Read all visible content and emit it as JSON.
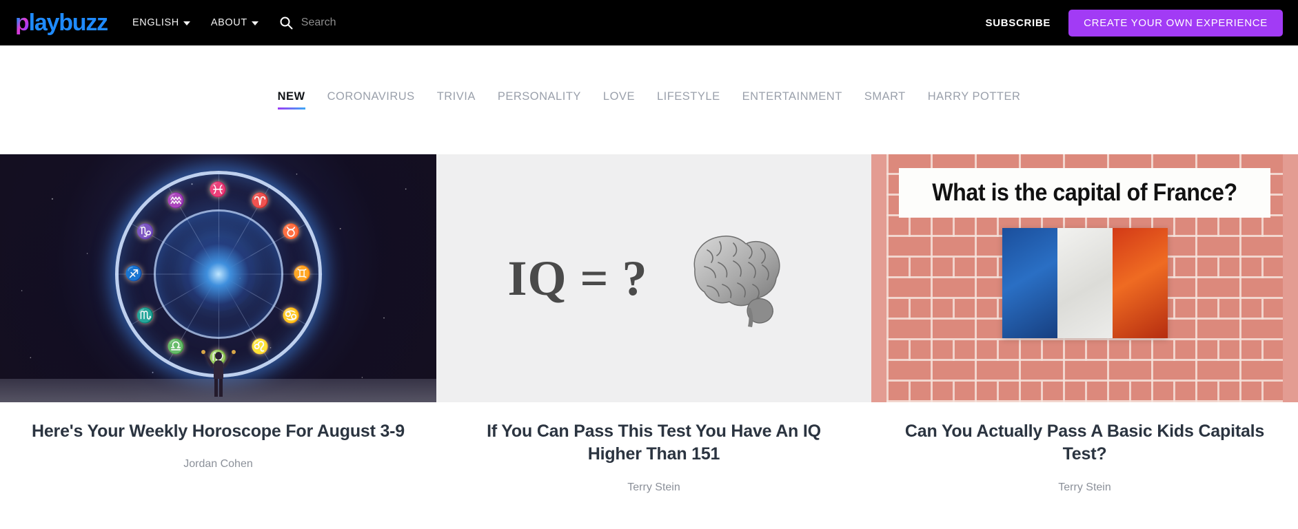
{
  "header": {
    "logo": {
      "prefix": "p",
      "suffix": "laybuzz",
      "full": "playbuzz"
    },
    "nav": [
      {
        "label": "ENGLISH",
        "icon": "chevron-down-icon"
      },
      {
        "label": "ABOUT",
        "icon": "chevron-down-icon"
      }
    ],
    "search": {
      "icon": "search-icon",
      "placeholder": "Search",
      "value": ""
    },
    "subscribe_label": "SUBSCRIBE",
    "create_label": "CREATE YOUR OWN EXPERIENCE",
    "colors": {
      "background": "#000000",
      "create_button": "#a23bf5",
      "logo_blue": "#1f8bff",
      "logo_pink": "#e23bd0"
    }
  },
  "tabs": {
    "active_index": 0,
    "items": [
      {
        "label": "NEW"
      },
      {
        "label": "CORONAVIRUS"
      },
      {
        "label": "TRIVIA"
      },
      {
        "label": "PERSONALITY"
      },
      {
        "label": "LOVE"
      },
      {
        "label": "LIFESTYLE"
      },
      {
        "label": "ENTERTAINMENT"
      },
      {
        "label": "SMART"
      },
      {
        "label": "HARRY POTTER"
      }
    ],
    "underline_gradient": [
      "#9b3bf5",
      "#3ba8f5"
    ]
  },
  "cards": [
    {
      "title": "Here's Your Weekly Horoscope For August 3-9",
      "author": "Jordan Cohen",
      "media": {
        "kind": "zodiac-wheel-image",
        "signs": [
          "♓",
          "♈",
          "♉",
          "♊",
          "♋",
          "♌",
          "♍",
          "♎",
          "♏",
          "♐",
          "♑",
          "♒"
        ]
      }
    },
    {
      "title": "If You Can Pass This Test You Have An IQ Higher Than 151",
      "author": "Terry Stein",
      "media": {
        "kind": "iq-brain-image",
        "text": "IQ = ?",
        "background": "#efeff0"
      }
    },
    {
      "title": "Can You Actually Pass A Basic Kids Capitals Test?",
      "author": "Terry Stein",
      "media": {
        "kind": "brick-wall-flag-image",
        "banner_text": "What is the capital of France?",
        "flag": "france",
        "background": "#d98072"
      }
    }
  ]
}
